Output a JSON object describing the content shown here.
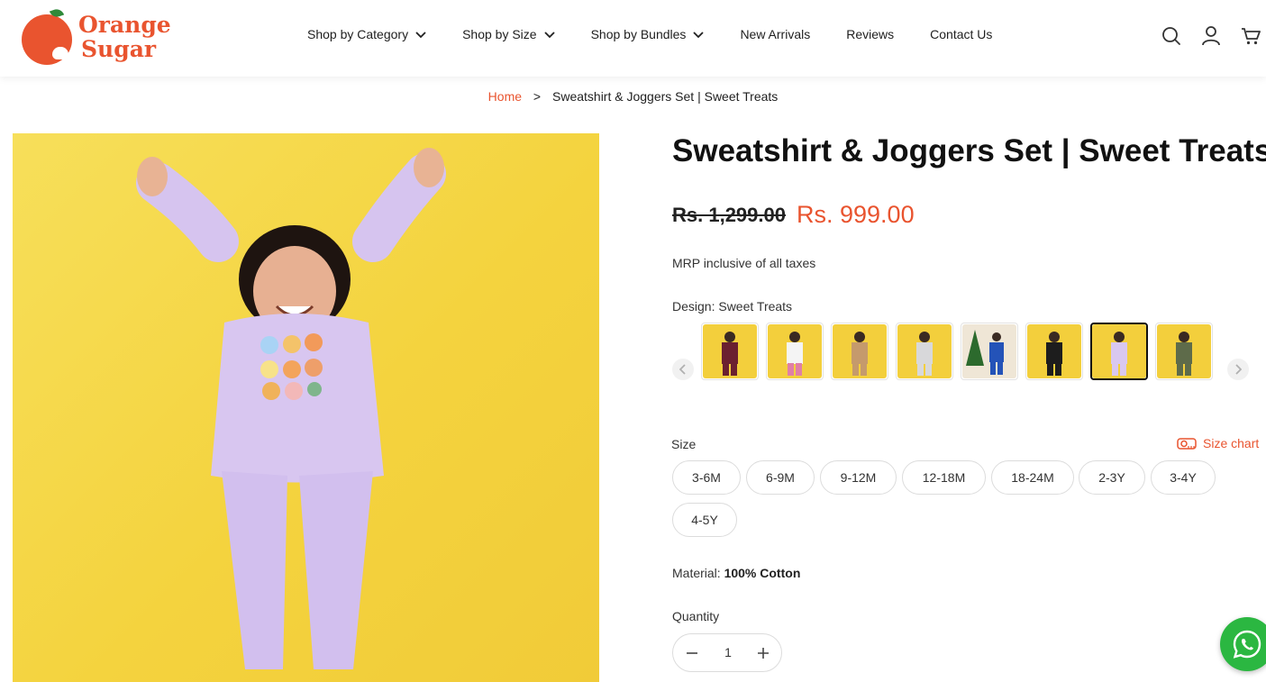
{
  "brand": {
    "name_line1": "Orange",
    "name_line2": "Sugar",
    "color": "#e9542f"
  },
  "nav": {
    "items": [
      {
        "label": "Shop by Category",
        "has_dropdown": true
      },
      {
        "label": "Shop by Size",
        "has_dropdown": true
      },
      {
        "label": "Shop by Bundles",
        "has_dropdown": true
      },
      {
        "label": "New Arrivals",
        "has_dropdown": false
      },
      {
        "label": "Reviews",
        "has_dropdown": false
      },
      {
        "label": "Contact Us",
        "has_dropdown": false
      }
    ],
    "icons": [
      "search-icon",
      "account-icon",
      "cart-icon"
    ]
  },
  "breadcrumb": {
    "home": "Home",
    "separator": ">",
    "current": "Sweatshirt & Joggers Set | Sweet Treats"
  },
  "product": {
    "title": "Sweatshirt & Joggers Set | Sweet Treats",
    "price_original": "Rs. 1,299.00",
    "price_sale": "Rs. 999.00",
    "tax_note": "MRP inclusive of all taxes",
    "design_label": "Design: Sweet Treats",
    "design_swatches": [
      {
        "name": "Maroon",
        "color": "#6b2030",
        "selected": false
      },
      {
        "name": "Pink",
        "color": "#e07fa6",
        "selected": false
      },
      {
        "name": "Tan",
        "color": "#c59a6c",
        "selected": false
      },
      {
        "name": "Grey",
        "color": "#d8d8da",
        "selected": false
      },
      {
        "name": "Royal Blue",
        "color": "#2453b8",
        "selected": false
      },
      {
        "name": "Black",
        "color": "#1d1d1d",
        "selected": false
      },
      {
        "name": "Sweet Treats",
        "color": "#d9c8f0",
        "selected": true
      },
      {
        "name": "Olive",
        "color": "#5e6b4a",
        "selected": false
      }
    ],
    "size_label": "Size",
    "size_chart_label": "Size chart",
    "sizes": [
      "3-6M",
      "6-9M",
      "9-12M",
      "12-18M",
      "18-24M",
      "2-3Y",
      "3-4Y",
      "4-5Y"
    ],
    "material_label": "Material:",
    "material_value": "100% Cotton",
    "quantity_label": "Quantity",
    "quantity": "1"
  },
  "colors": {
    "accent": "#e9542f",
    "image_background": "#f4d33e",
    "whatsapp": "#2bb741"
  }
}
